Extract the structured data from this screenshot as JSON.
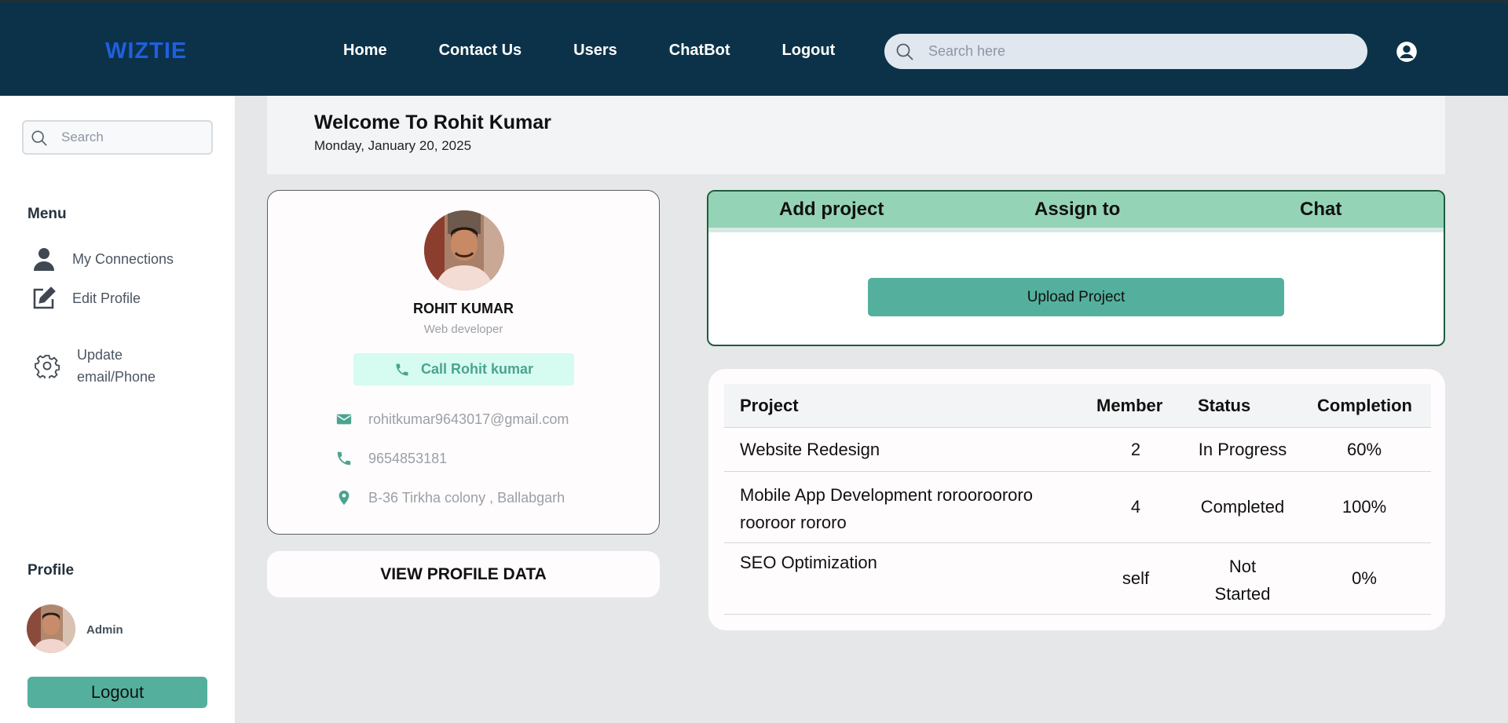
{
  "navbar": {
    "brand": "WIZTIE",
    "links": [
      "Home",
      "Contact Us",
      "Users",
      "ChatBot",
      "Logout"
    ],
    "search_placeholder": "Search here"
  },
  "sidebar": {
    "search_placeholder": "Search",
    "menu_heading": "Menu",
    "items": [
      {
        "label": "My Connections",
        "icon": "user-icon"
      },
      {
        "label": "Edit Profile",
        "icon": "edit-icon"
      },
      {
        "label_line1": "Update",
        "label_line2": "email/Phone",
        "icon": "gear-icon"
      }
    ],
    "profile_heading": "Profile",
    "profile_name": "Admin",
    "logout_label": "Logout"
  },
  "welcome": {
    "title": "Welcome To Rohit Kumar",
    "date": "Monday, January 20, 2025"
  },
  "profile": {
    "name": "ROHIT KUMAR",
    "role": "Web developer",
    "call_label": "Call Rohit kumar",
    "email": "rohitkumar9643017@gmail.com",
    "phone": "9654853181",
    "address": "B-36 Tirkha colony , Ballabgarh",
    "view_label": "VIEW PROFILE DATA"
  },
  "project_actions": {
    "tabs": [
      "Add project",
      "Assign to",
      "Chat"
    ],
    "upload_label": "Upload Project"
  },
  "projects": {
    "headers": [
      "Project",
      "Member",
      "Status",
      "Completion"
    ],
    "rows": [
      {
        "name_line1": "Website Redesign",
        "name_line2": "",
        "member": "2",
        "status_line1": "In Progress",
        "status_line2": "",
        "completion": "60%"
      },
      {
        "name_line1": "Mobile App Development rorooroororo",
        "name_line2": "rooroor rororo",
        "member": "4",
        "status_line1": "Completed",
        "status_line2": "",
        "completion": "100%"
      },
      {
        "name_line1": "SEO Optimization",
        "name_line2": "",
        "member": "self",
        "status_line1": "Not",
        "status_line2": "Started",
        "completion": "0%"
      }
    ]
  },
  "colors": {
    "navbar_bg": "#0b3248",
    "brand": "#1f5fe0",
    "accent_green": "#54b09d",
    "tab_bar": "#95d3b6",
    "call_bg": "#d6fbf1"
  }
}
